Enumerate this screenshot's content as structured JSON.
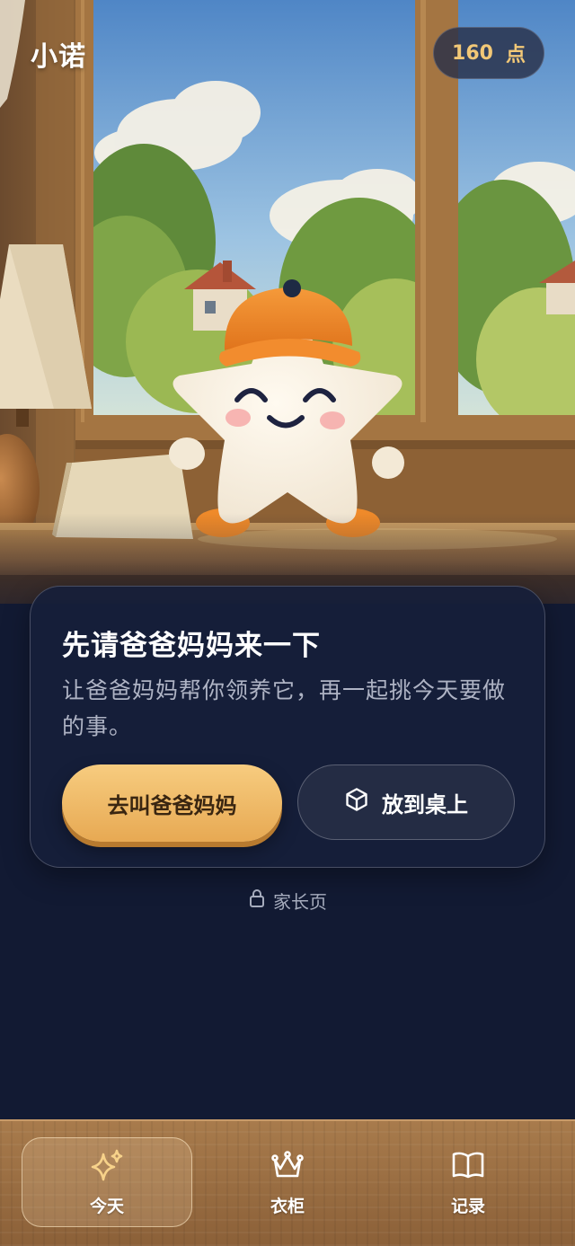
{
  "header": {
    "app_title": "小诺",
    "points_value": "160",
    "points_unit": "点"
  },
  "card": {
    "title": "先请爸爸妈妈来一下",
    "description": "让爸爸妈妈帮你领养它，再一起挑今天要做的事。",
    "primary_button": "去叫爸爸妈妈",
    "secondary_button": "放到桌上",
    "secondary_icon": "cube-icon"
  },
  "parent_link": {
    "label": "家长页",
    "icon": "lock-icon"
  },
  "nav": {
    "items": [
      {
        "label": "今天",
        "icon": "sparkles-icon",
        "active": true
      },
      {
        "label": "衣柜",
        "icon": "crown-icon",
        "active": false
      },
      {
        "label": "记录",
        "icon": "book-icon",
        "active": false
      }
    ]
  },
  "colors": {
    "background": "#121a33",
    "accent": "#f2c877",
    "primary_button": "#f0b866",
    "nav_wood": "#9a6d42"
  }
}
